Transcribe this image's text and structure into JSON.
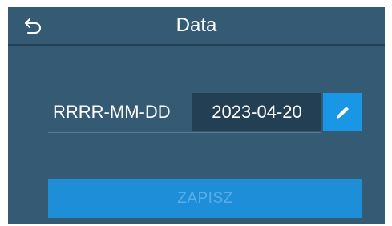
{
  "header": {
    "title": "Data",
    "back_icon": "undo-arrow-icon"
  },
  "date": {
    "format_label": "RRRR-MM-DD",
    "value": "2023-04-20",
    "edit_icon": "pencil-icon"
  },
  "actions": {
    "save_label": "ZAPISZ",
    "save_enabled": false
  },
  "colors": {
    "background": "#345a74",
    "field_background": "#233f53",
    "accent": "#1a96e6",
    "disabled_text": "#57aee8"
  }
}
